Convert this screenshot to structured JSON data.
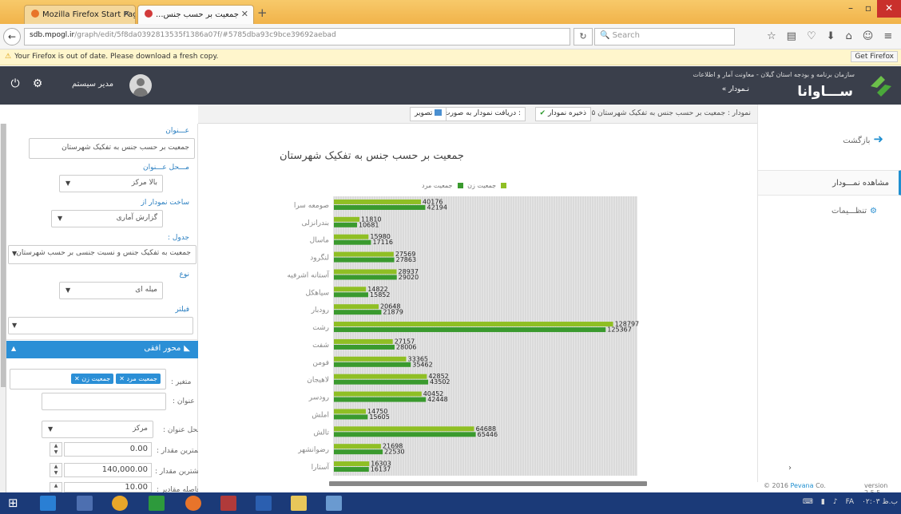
{
  "browser": {
    "tabs": [
      {
        "label": "Mozilla Firefox Start Page"
      },
      {
        "label": "...جمعیت بر حسب جنس"
      }
    ],
    "url_domain": "sdb.mpogl.ir",
    "url_path": "/graph/edit/5f8da0392813535f1386a07f/#5785dba93c9bce39692aebad",
    "search_placeholder": "Search",
    "update_warning": "Your Firefox is out of date. Please download a fresh copy.",
    "get_firefox_label": "Get Firefox"
  },
  "header": {
    "username": "مدیر سیستم",
    "org_name": "سازمان برنامه و بودجه استان گیلان - معاونت آمار و اطلاعات",
    "brand": "ســـاوانا",
    "nav_chart": "« نـمودار"
  },
  "toolbar": {
    "title": "نمودار : جمعیت بر حسب جنس به تفکیک شهرستان ۱۳۸۵",
    "save_label": "ذخیره نمودار",
    "download_label": "دریافت نمودار به صورت :",
    "image_label": "تصویر"
  },
  "rightnav": {
    "back_label": "بازگشت",
    "view_chart_label": "مشاهده نمـــودار",
    "settings_label": "تنظـــیمات",
    "chevron": "›",
    "copyright_prefix": "© 2016",
    "copyright_link": "Pevana",
    "copyright_suffix": "Co.",
    "version": "version 2.5.5"
  },
  "settings": {
    "title_label": "عـــنوان",
    "title_value": "جمعیت بر حسب جنس به تفکیک شهرستان",
    "title_pos_label": "مـــحل عـــنوان",
    "title_pos_value": "بالا مرکز",
    "build_from_label": "ساخت نمودار از",
    "build_from_value": "گزارش آماری",
    "table_label": "جدول :",
    "table_value": "جمعیت به تفکیک جنس و نسبت جنسی بر حسب شهرستان",
    "type_label": "نوع",
    "type_value": "میله ای",
    "filter_label": "فیلتر",
    "filter_value": ""
  },
  "axis_panel": {
    "header": "محور افقی",
    "variable_label": "متغیر :",
    "variable_tags": [
      "جمعیت مرد",
      "جمعیت زن"
    ],
    "title_label": "عنوان :",
    "title_value": "",
    "title_pos_label": "محل عنوان :",
    "title_pos_value": "مرکز",
    "min_label": "کمترین مقدار :",
    "min_value": "0.00",
    "max_label": "بیشترین مقدار :",
    "max_value": "140,000.00",
    "interval_label": "فاصله مقادیر :",
    "interval_value": "10.00"
  },
  "chart_data": {
    "type": "bar",
    "orientation": "horizontal",
    "title": "جمعیت بر حسب جنس به تفکیک شهرستان",
    "legend": [
      "جمعیت زن",
      "جمعیت مرد"
    ],
    "legend_placement": "top",
    "categories": [
      "صومعه سرا",
      "بندرانزلی",
      "ماسال",
      "لنگرود",
      "آستانه اشرفیه",
      "سیاهکل",
      "رودبار",
      "رشت",
      "شفت",
      "فومن",
      "لاهیجان",
      "رودسر",
      "املش",
      "تالش",
      "رضوانشهر",
      "آستارا"
    ],
    "series": [
      {
        "name": "جمعیت زن",
        "color": "#8fbf24",
        "values": [
          40176,
          11810,
          15980,
          27569,
          28937,
          14822,
          20648,
          128797,
          27157,
          33365,
          42852,
          40452,
          14750,
          64688,
          21698,
          16303
        ]
      },
      {
        "name": "جمعیت مرد",
        "color": "#3a9a2e",
        "values": [
          42194,
          10681,
          17116,
          27863,
          29020,
          15852,
          21879,
          125367,
          28006,
          35462,
          43502,
          42448,
          15605,
          65446,
          22530,
          16137
        ]
      }
    ],
    "xlim": [
      0,
      140000
    ],
    "grid": true
  },
  "taskbar": {
    "tray_lang": "FA",
    "tray_time": "۰۲:۰۳ ب.ظ"
  }
}
